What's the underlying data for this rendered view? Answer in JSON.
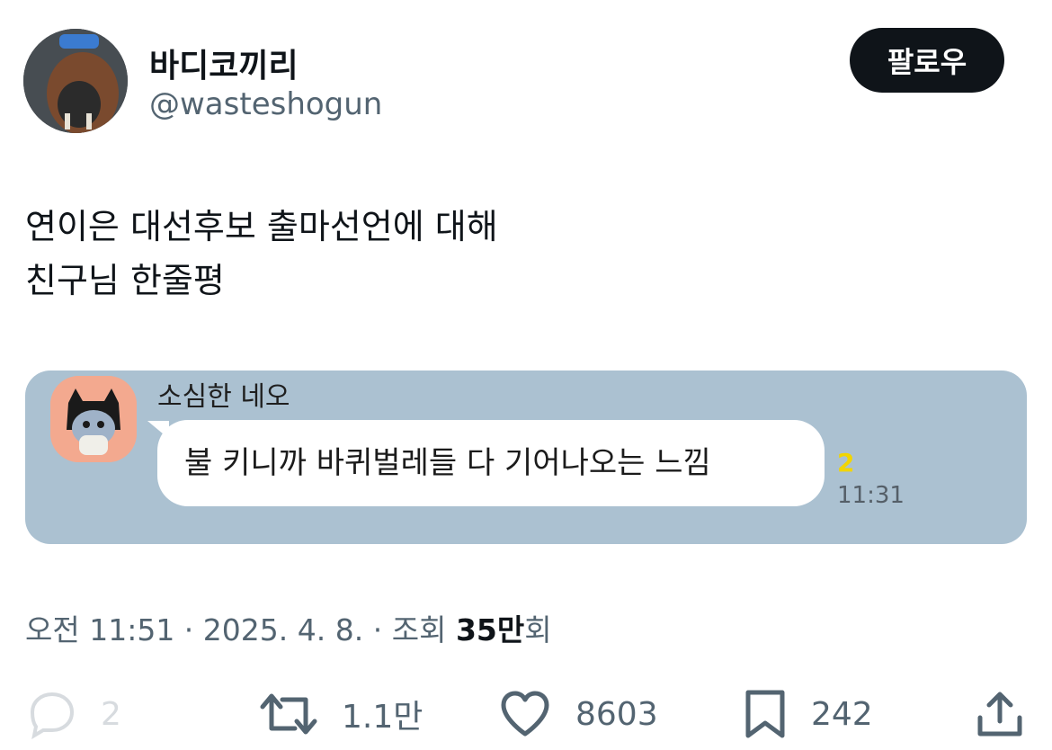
{
  "author": {
    "name": "바디코끼리",
    "handle": "@wasteshogun",
    "avatar_icon": "walrus-avatar"
  },
  "follow_button": {
    "label": "팔로우"
  },
  "tweet": {
    "lines": [
      "연이은 대선후보 출마선언에 대해",
      "친구님 한줄평"
    ]
  },
  "chat_image": {
    "background": "#abc1d1",
    "sender_name": "소심한 네오",
    "avatar_icon": "neo-character-avatar",
    "message": "불 키니까 바퀴벌레들 다 기어나오는 느낌",
    "unread_count": "2",
    "time": "11:31"
  },
  "meta": {
    "time": "오전 11:51",
    "separator": " · ",
    "date": "2025. 4. 8.",
    "views_label": "조회",
    "views_value": "35만",
    "views_suffix": "회"
  },
  "actions": [
    {
      "icon": "reply-icon",
      "count": "2"
    },
    {
      "icon": "retweet-icon",
      "count": "1.1만"
    },
    {
      "icon": "like-icon",
      "count": "8603"
    },
    {
      "icon": "bookmark-icon",
      "count": "242"
    },
    {
      "icon": "share-icon"
    }
  ]
}
